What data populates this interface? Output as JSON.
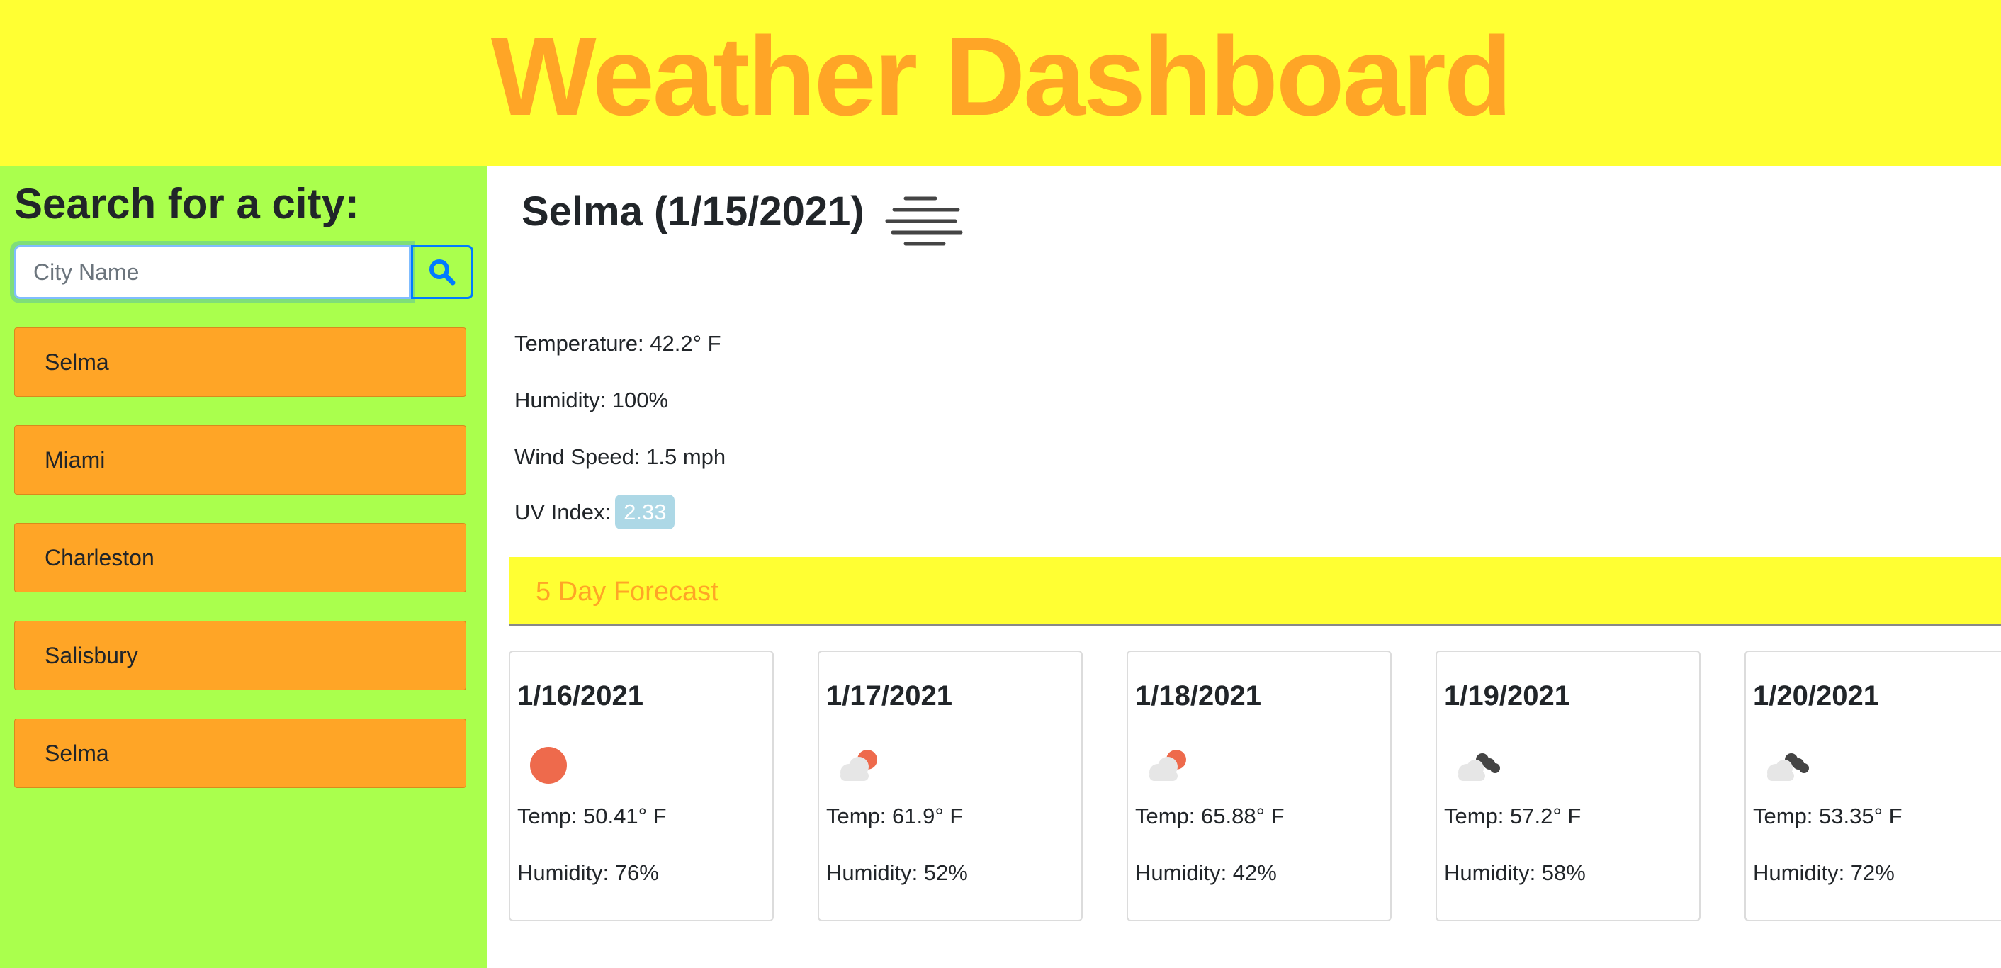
{
  "header": {
    "title": "Weather Dashboard"
  },
  "colors": {
    "header_bg": "#ffff33",
    "title": "#ffa526",
    "sidebar_bg": "#aaff4d",
    "city_button": "#ffa526",
    "uv_badge": "#add8e6"
  },
  "sidebar": {
    "heading": "Search for a city:",
    "search": {
      "placeholder": "City Name",
      "value": "",
      "button_icon": "search-icon"
    },
    "history": [
      {
        "label": "Selma"
      },
      {
        "label": "Miami"
      },
      {
        "label": "Charleston"
      },
      {
        "label": "Salisbury"
      },
      {
        "label": "Selma"
      }
    ]
  },
  "current": {
    "title": "Selma (1/15/2021)",
    "icon": "mist-icon",
    "temperature": "Temperature: 42.2° F",
    "humidity": "Humidity: 100%",
    "wind": "Wind Speed: 1.5 mph",
    "uv_label": "UV Index:",
    "uv_value": "2.33"
  },
  "forecast": {
    "heading": "5 Day Forecast",
    "days": [
      {
        "date": "1/16/2021",
        "icon": "sun-icon",
        "temp": "Temp: 50.41° F",
        "humidity": "Humidity: 76%"
      },
      {
        "date": "1/17/2021",
        "icon": "partly-cloudy-icon",
        "temp": "Temp: 61.9° F",
        "humidity": "Humidity: 52%"
      },
      {
        "date": "1/18/2021",
        "icon": "partly-cloudy-icon",
        "temp": "Temp: 65.88° F",
        "humidity": "Humidity: 42%"
      },
      {
        "date": "1/19/2021",
        "icon": "broken-clouds-icon",
        "temp": "Temp: 57.2° F",
        "humidity": "Humidity: 58%"
      },
      {
        "date": "1/20/2021",
        "icon": "broken-clouds-icon",
        "temp": "Temp: 53.35° F",
        "humidity": "Humidity: 72%"
      }
    ]
  }
}
